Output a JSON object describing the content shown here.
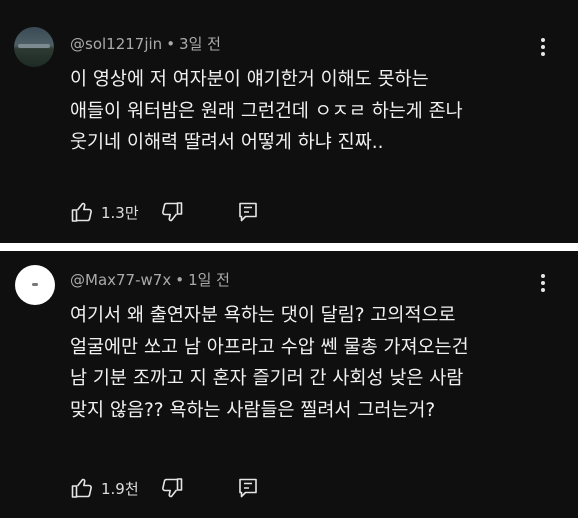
{
  "comments": [
    {
      "handle": "@sol1217jin",
      "separator": "•",
      "time": "3일 전",
      "lines": [
        "이 영상에 저 여자분이 얘기한거 이해도 못하는",
        "애들이 워터밤은 원래 그런건데 ㅇㅈㄹ 하는게 존나",
        "웃기네 이해력 딸려서 어떻게 하냐 진짜.."
      ],
      "likes": "1.3만"
    },
    {
      "handle": "@Max77-w7x",
      "separator": "•",
      "time": "1일 전",
      "lines": [
        "여기서 왜 출연자분 욕하는 댓이 달림? 고의적으로",
        "얼굴에만 쏘고 남 아프라고 수압 쎈 물총 가져오는건",
        "남 기분 조까고 지 혼자 즐기러 간 사회성 낮은 사람",
        "맞지 않음?? 욕하는 사람들은 찔려서 그러는거?"
      ],
      "likes": "1.9천"
    }
  ],
  "icons": {
    "like": "thumbs-up-icon",
    "dislike": "thumbs-down-icon",
    "reply": "reply-icon",
    "more": "more-vertical-icon"
  }
}
